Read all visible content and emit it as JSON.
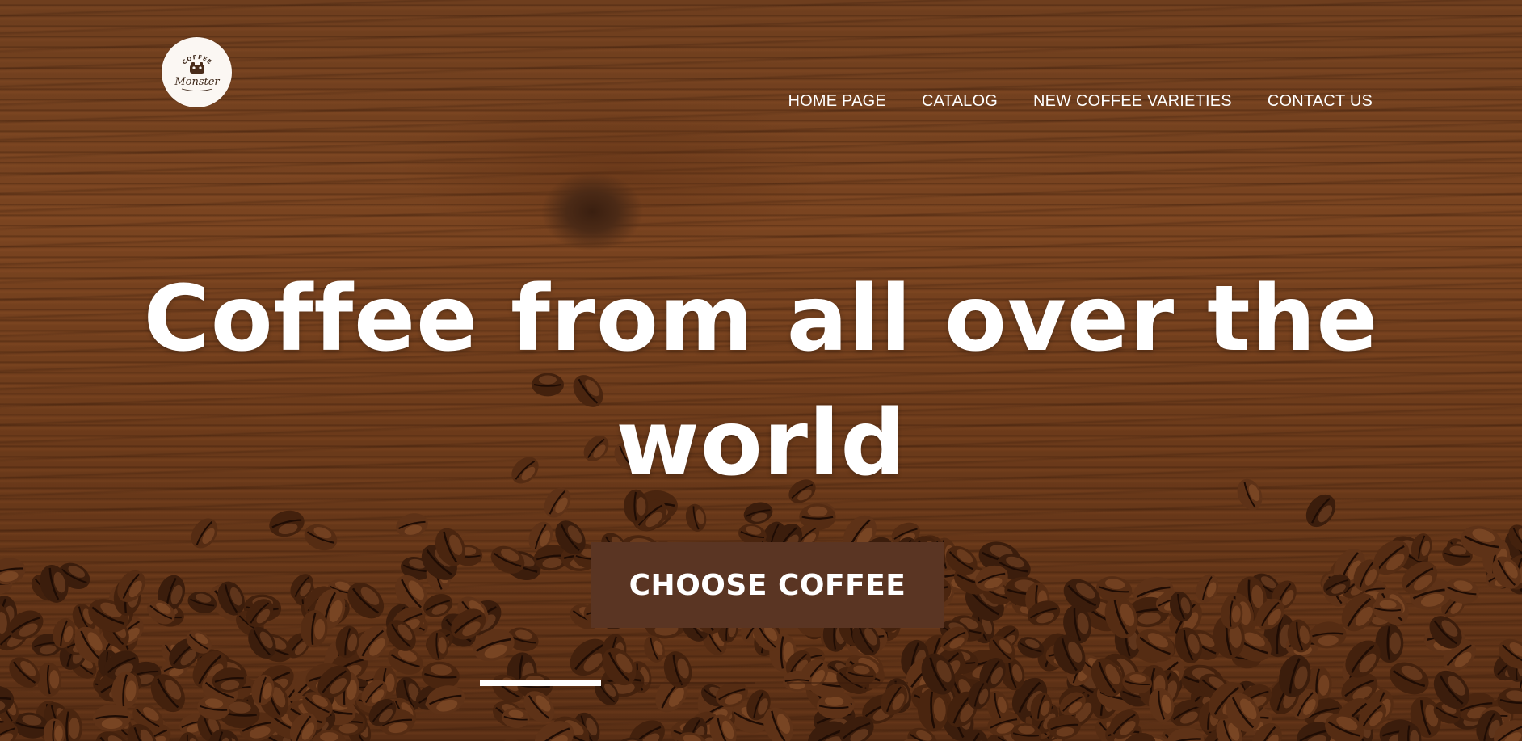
{
  "logo": {
    "top_text": "COFFEE",
    "script_text": "Monster"
  },
  "nav": {
    "items": [
      {
        "label": "HOME PAGE"
      },
      {
        "label": "CATALOG"
      },
      {
        "label": "NEW COFFEE VARIETIES"
      },
      {
        "label": "CONTACT US"
      }
    ]
  },
  "hero": {
    "headline_line1": "Coffee from all over the",
    "headline_line2": "world",
    "cta_label": "CHOOSE COFFEE"
  },
  "slider": {
    "slides": 3,
    "active_slide": 1
  },
  "colors": {
    "cta_background": "#5a3523",
    "text": "#ffffff",
    "logo_background": "#fbf7f3"
  }
}
